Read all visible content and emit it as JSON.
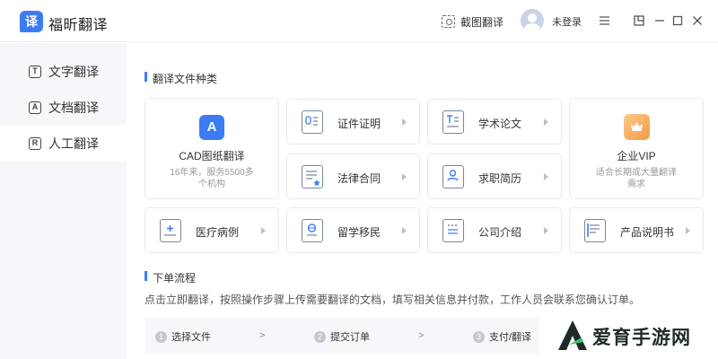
{
  "app": {
    "logo_char": "译",
    "title": "福昕翻译"
  },
  "header": {
    "screenshot_translate": "截图翻译",
    "login_status": "未登录",
    "window_controls": [
      "menu-icon",
      "pin-icon",
      "minimize-icon",
      "maximize-icon",
      "close-icon"
    ]
  },
  "sidebar": {
    "items": [
      {
        "label": "文字翻译",
        "icon_char": "T",
        "active": false
      },
      {
        "label": "文档翻译",
        "icon_char": "A",
        "active": false
      },
      {
        "label": "人工翻译",
        "icon_char": "R",
        "active": true
      }
    ]
  },
  "main": {
    "section1_title": "翻译文件种类",
    "cad_card": {
      "title": "CAD图纸翻译",
      "subtitle_line1": "16年来，服务5500多",
      "subtitle_line2": "个机构",
      "icon_char": "A"
    },
    "enterprise_card": {
      "title": "企业VIP",
      "subtitle_line1": "适合长期或大量翻译",
      "subtitle_line2": "需求"
    },
    "categories": [
      {
        "label": "证件证明"
      },
      {
        "label": "学术论文"
      },
      {
        "label": "法律合同"
      },
      {
        "label": "求职简历"
      },
      {
        "label": "医疗病例"
      },
      {
        "label": "留学移民"
      },
      {
        "label": "公司介绍"
      },
      {
        "label": "产品说明书"
      }
    ],
    "section2_title": "下单流程",
    "flow_description": "点击立即翻译，按照操作步骤上传需要翻译的文档，填写相关信息并付款，工作人员会联系您确认订单。",
    "steps": [
      {
        "num": "1",
        "label": "选择文件"
      },
      {
        "num": "2",
        "label": "提交订单"
      },
      {
        "num": "3",
        "label": "支付/翻译"
      }
    ],
    "step_separator": ">"
  },
  "watermark": {
    "text": "爱育手游网"
  },
  "colors": {
    "accent": "#3b7cf5",
    "enterprise_orange": "#f5a24a",
    "sidebar_bg": "#f5f7fa"
  }
}
